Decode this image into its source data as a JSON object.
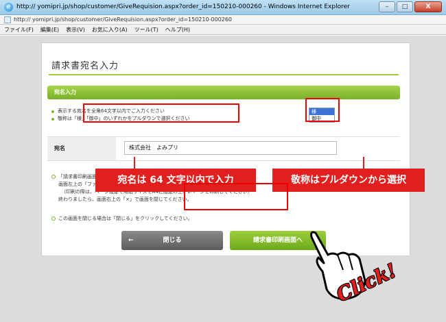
{
  "window": {
    "title": "http://  yomipri.jp/shop/customer/GiveRequision.aspx?order_id=150210-000260 - Windows Internet Explorer",
    "url": "http://  yomipri.jp/shop/customer/GiveRequision.aspx?order_id=150210-000260",
    "minimize": "–",
    "maximize": "□",
    "close": "X"
  },
  "menu": [
    "ファイル(F)",
    "編集(E)",
    "表示(V)",
    "お気に入り(A)",
    "ツール(T)",
    "ヘルプ(H)"
  ],
  "page": {
    "title": "請求書宛名入力",
    "section": "宛名入力",
    "notes": [
      "表示する宛名を全角64文字以内でご入力ください",
      "敬称は「様」「御中」のいずれかをプルダウンで選択ください"
    ],
    "field_label": "宛名",
    "field_value": "株式会社　よみプリ",
    "honorific_options": [
      "様",
      "御中"
    ],
    "info_lines": [
      "「請求書印刷画面へ」をクリックすると、請求書印刷画面が表示されます。",
      "画面左上の「ファイル」→「印刷」で請求書を印刷してください。",
      "（印刷の際は、ページ設定で用紙サイズをA4に設定の上、1ページを印刷してください）",
      "終わりましたら、画面右上の「×」で画面を閉じてください。"
    ],
    "info_close": "この画面を閉じる場合は「閉じる」をクリックしてください。",
    "close_button": "閉じる",
    "close_arrow": "←",
    "print_button": "請求書印刷画面へ"
  },
  "callouts": {
    "left": "宛名は 64 文字以内で入力",
    "right": "敬称はプルダウンから選択",
    "click": "Click!"
  }
}
